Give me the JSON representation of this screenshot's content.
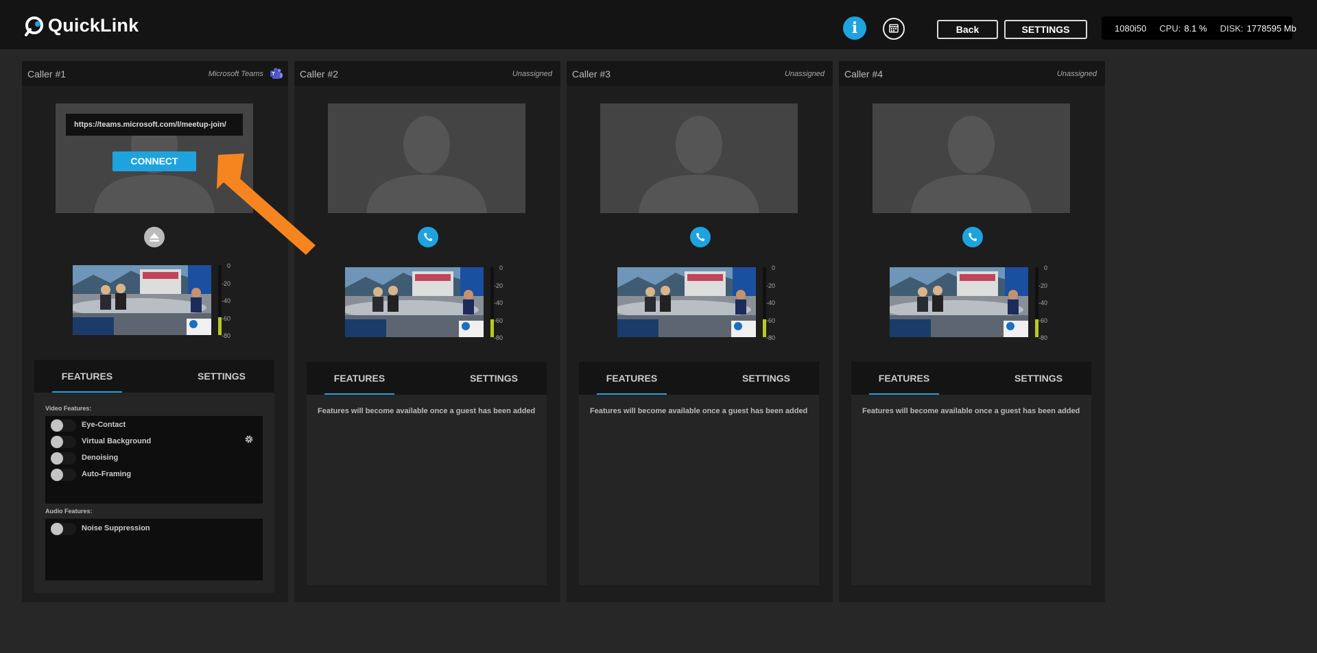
{
  "header": {
    "logo_text": "QuickLink",
    "info_label": "i",
    "back_label": "Back",
    "settings_label": "SETTINGS",
    "stats": {
      "format": "1080i50",
      "cpu_label": "CPU:",
      "cpu_value": "8.1 %",
      "disk_label": "DISK:",
      "disk_value": "1778595 Mb"
    }
  },
  "callers": [
    {
      "title": "Caller #1",
      "status": "Microsoft Teams",
      "url_value": "https://teams.microsoft.com/l/meetup-join/",
      "connect_label": "CONNECT",
      "meter_level": 0.25,
      "tabs": [
        "FEATURES",
        "SETTINGS"
      ],
      "video_features_label": "Video Features:",
      "video_features": [
        "Eye-Contact",
        "Virtual Background",
        "Denoising",
        "Auto-Framing"
      ],
      "audio_features_label": "Audio Features:",
      "audio_features": [
        "Noise Suppression"
      ]
    },
    {
      "title": "Caller #2",
      "status": "Unassigned",
      "meter_level": 0.25,
      "tabs": [
        "FEATURES",
        "SETTINGS"
      ],
      "empty_message": "Features will become available once a guest has been added"
    },
    {
      "title": "Caller #3",
      "status": "Unassigned",
      "meter_level": 0.25,
      "tabs": [
        "FEATURES",
        "SETTINGS"
      ],
      "empty_message": "Features will become available once a guest has been added"
    },
    {
      "title": "Caller #4",
      "status": "Unassigned",
      "meter_level": 0.25,
      "tabs": [
        "FEATURES",
        "SETTINGS"
      ],
      "empty_message": "Features will become available once a guest has been added"
    }
  ],
  "meter_scale": [
    "0",
    "-20",
    "-40",
    "-60",
    "-80"
  ],
  "colors": {
    "accent": "#1ea3df",
    "annotation_arrow": "#f7851f",
    "meter_level": "#b5cc1a"
  }
}
